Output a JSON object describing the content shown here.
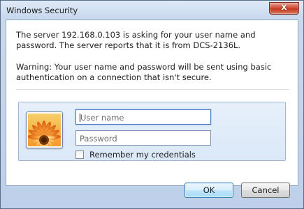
{
  "window": {
    "title": "Windows Security",
    "close_glyph": "x"
  },
  "message": {
    "line1": "The server 192.168.0.103 is asking for your user name and password. The server reports that it is from DCS-2136L.",
    "warning": "Warning: Your user name and password will be sent using basic authentication on a connection that isn't secure."
  },
  "credentials": {
    "user_icon": "user-tile-flower-icon",
    "username_placeholder": "User name",
    "username_value": "",
    "password_placeholder": "Password",
    "password_value": "",
    "remember_label": "Remember my credentials",
    "remember_checked": false
  },
  "buttons": {
    "ok_label": "OK",
    "cancel_label": "Cancel"
  },
  "colors": {
    "close_button": "#c23a22",
    "ok_button": "#bee6fd",
    "credential_panel": "#dbe8f7"
  }
}
